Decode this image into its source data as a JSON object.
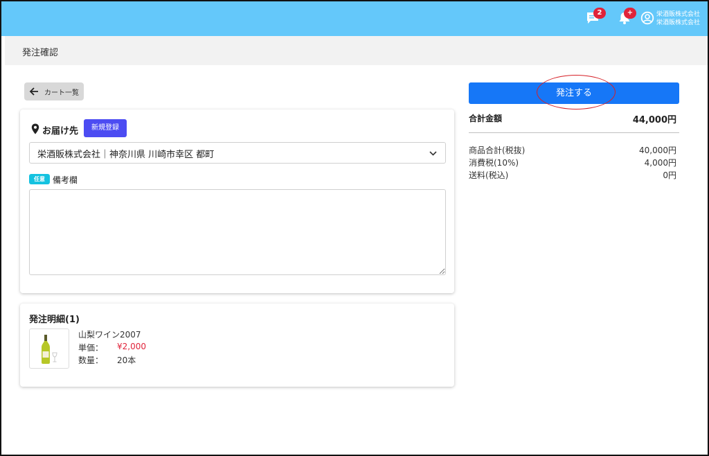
{
  "header": {
    "chat_badge": "2",
    "bell_badge": "+",
    "company_line1": "栄酒販株式会社",
    "company_line2": "栄酒販株式会社",
    "bar_color": "#64c8fa",
    "badge_color": "#e0233a",
    "icons": [
      "chat-icon",
      "bell-icon",
      "user-circle-icon"
    ]
  },
  "page": {
    "title": "発注確認"
  },
  "back_button": {
    "label": "カート一覧",
    "icon": "arrow-left-icon"
  },
  "delivery": {
    "label": "お届け先",
    "icon": "map-pin-icon",
    "new_button": "新規登録",
    "selected_address": "栄酒販株式会社｜神奈川県 川崎市幸区 都町",
    "optional_badge": "任意",
    "remarks_label": "備考欄",
    "remarks_value": ""
  },
  "order_details": {
    "title": "発注明細(1)",
    "item": {
      "name": "山梨ワイン2007",
      "price_label": "単価：",
      "price": "¥2,000",
      "qty_label": "数量：",
      "qty": "20本",
      "price_color": "#e0233a"
    }
  },
  "summary": {
    "order_button": "発注する",
    "total_label": "合計金額",
    "total_value": "44,000円",
    "lines": [
      {
        "label": "商品合計(税抜)",
        "value": "40,000円"
      },
      {
        "label": "消費税(10%)",
        "value": "4,000円"
      },
      {
        "label": "送料(税込)",
        "value": "0円"
      }
    ],
    "accent_color": "#1677f7",
    "highlight_circle_color": "#d61f26"
  }
}
